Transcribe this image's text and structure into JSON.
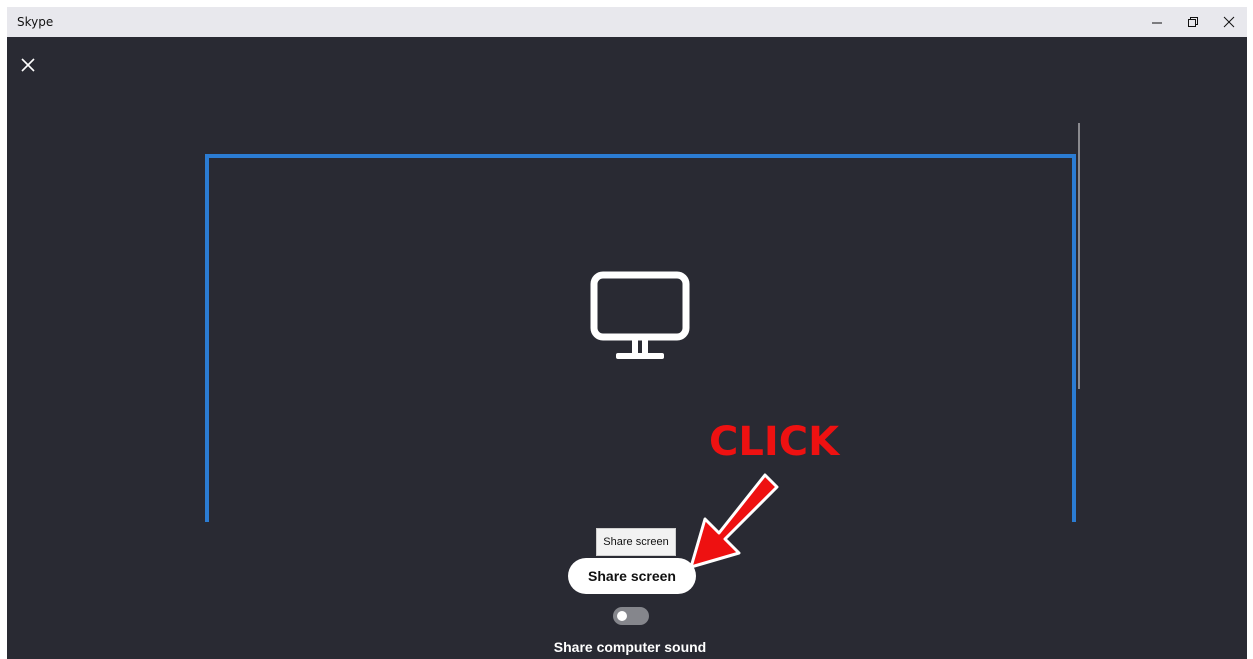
{
  "window": {
    "title": "Skype",
    "controls": {
      "minimize": "minimize-icon",
      "restore": "restore-icon",
      "close": "close-icon"
    }
  },
  "dialog": {
    "close_icon": "close-icon"
  },
  "preview": {
    "icon": "monitor-icon",
    "frame_color": "#2b7cd3"
  },
  "annotation": {
    "text": "CLICK",
    "color": "#ee1111"
  },
  "tooltip": {
    "text": "Share screen"
  },
  "share_button": {
    "label": "Share screen"
  },
  "computer_sound": {
    "label": "Share computer sound",
    "enabled": false
  }
}
